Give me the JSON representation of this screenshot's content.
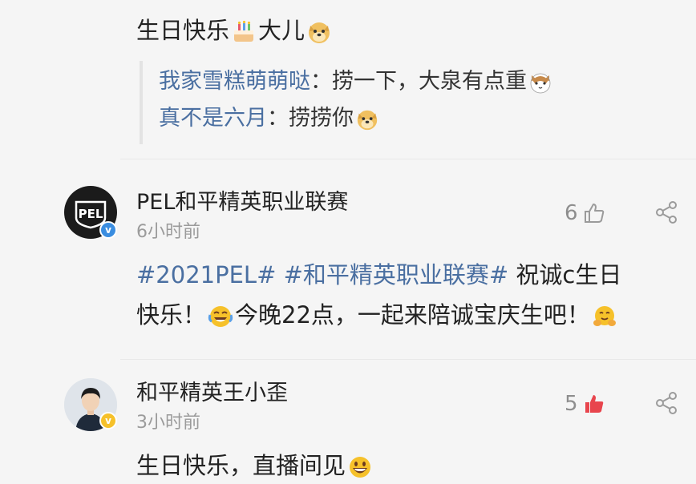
{
  "top_comment": {
    "text_a": "生日快乐",
    "text_b": "大儿",
    "emoji_1": "cake-emoji",
    "emoji_2": "doge-emoji"
  },
  "replies": [
    {
      "name": "我家雪糕萌萌哒",
      "sep": "：",
      "text": "捞一下，大泉有点重",
      "emoji": "cat-emoji"
    },
    {
      "name": "真不是六月",
      "sep": "：",
      "text": "捞捞你",
      "emoji": "doge-emoji"
    }
  ],
  "comments": [
    {
      "username": "PEL和平精英职业联赛",
      "time": "6小时前",
      "likes": "6",
      "liked": false,
      "tag1": "#2021PEL#",
      "tag2": "#和平精英职业联赛#",
      "line1_rest": "祝诚c生日",
      "line2_a": "快乐！",
      "line2_b": "今晚22点，一起来陪诚宝庆生吧！",
      "avatar_text": "PEL"
    },
    {
      "username": "和平精英王小歪",
      "time": "3小时前",
      "likes": "5",
      "liked": true,
      "text": "生日快乐，直播间见"
    }
  ],
  "colors": {
    "link": "#4a6fa1",
    "like_active": "#e8454d",
    "meta": "#9b9b9b"
  }
}
